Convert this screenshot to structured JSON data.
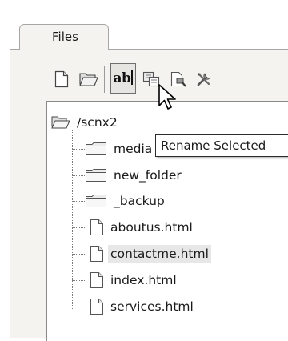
{
  "tabs": [
    {
      "label": "Files",
      "active": true
    }
  ],
  "toolbar": {
    "buttons": [
      {
        "name": "new-file",
        "icon": "new-file-icon"
      },
      {
        "name": "open-folder",
        "icon": "open-folder-icon"
      },
      {
        "name": "rename",
        "icon": "rename-icon",
        "text": "ab",
        "active": true
      },
      {
        "name": "copy",
        "icon": "copy-icon"
      },
      {
        "name": "properties",
        "icon": "file-search-icon"
      },
      {
        "name": "tools",
        "icon": "tools-icon"
      }
    ]
  },
  "tooltip": {
    "text": "Rename Selected"
  },
  "tree": {
    "root": {
      "label": "/scnx2",
      "icon": "open-folder-icon"
    },
    "items": [
      {
        "label": "media",
        "icon": "folder-icon"
      },
      {
        "label": "new_folder",
        "icon": "folder-icon"
      },
      {
        "label": "_backup",
        "icon": "folder-icon"
      },
      {
        "label": "aboutus.html",
        "icon": "file-icon"
      },
      {
        "label": "contactme.html",
        "icon": "file-icon",
        "selected": true
      },
      {
        "label": "index.html",
        "icon": "file-icon"
      },
      {
        "label": "services.html",
        "icon": "file-icon"
      }
    ]
  },
  "colors": {
    "panel_bg": "#f4f3ef",
    "tree_bg": "#ffffff",
    "selection_bg": "#e7e7e7",
    "border": "#a6a6a6"
  }
}
